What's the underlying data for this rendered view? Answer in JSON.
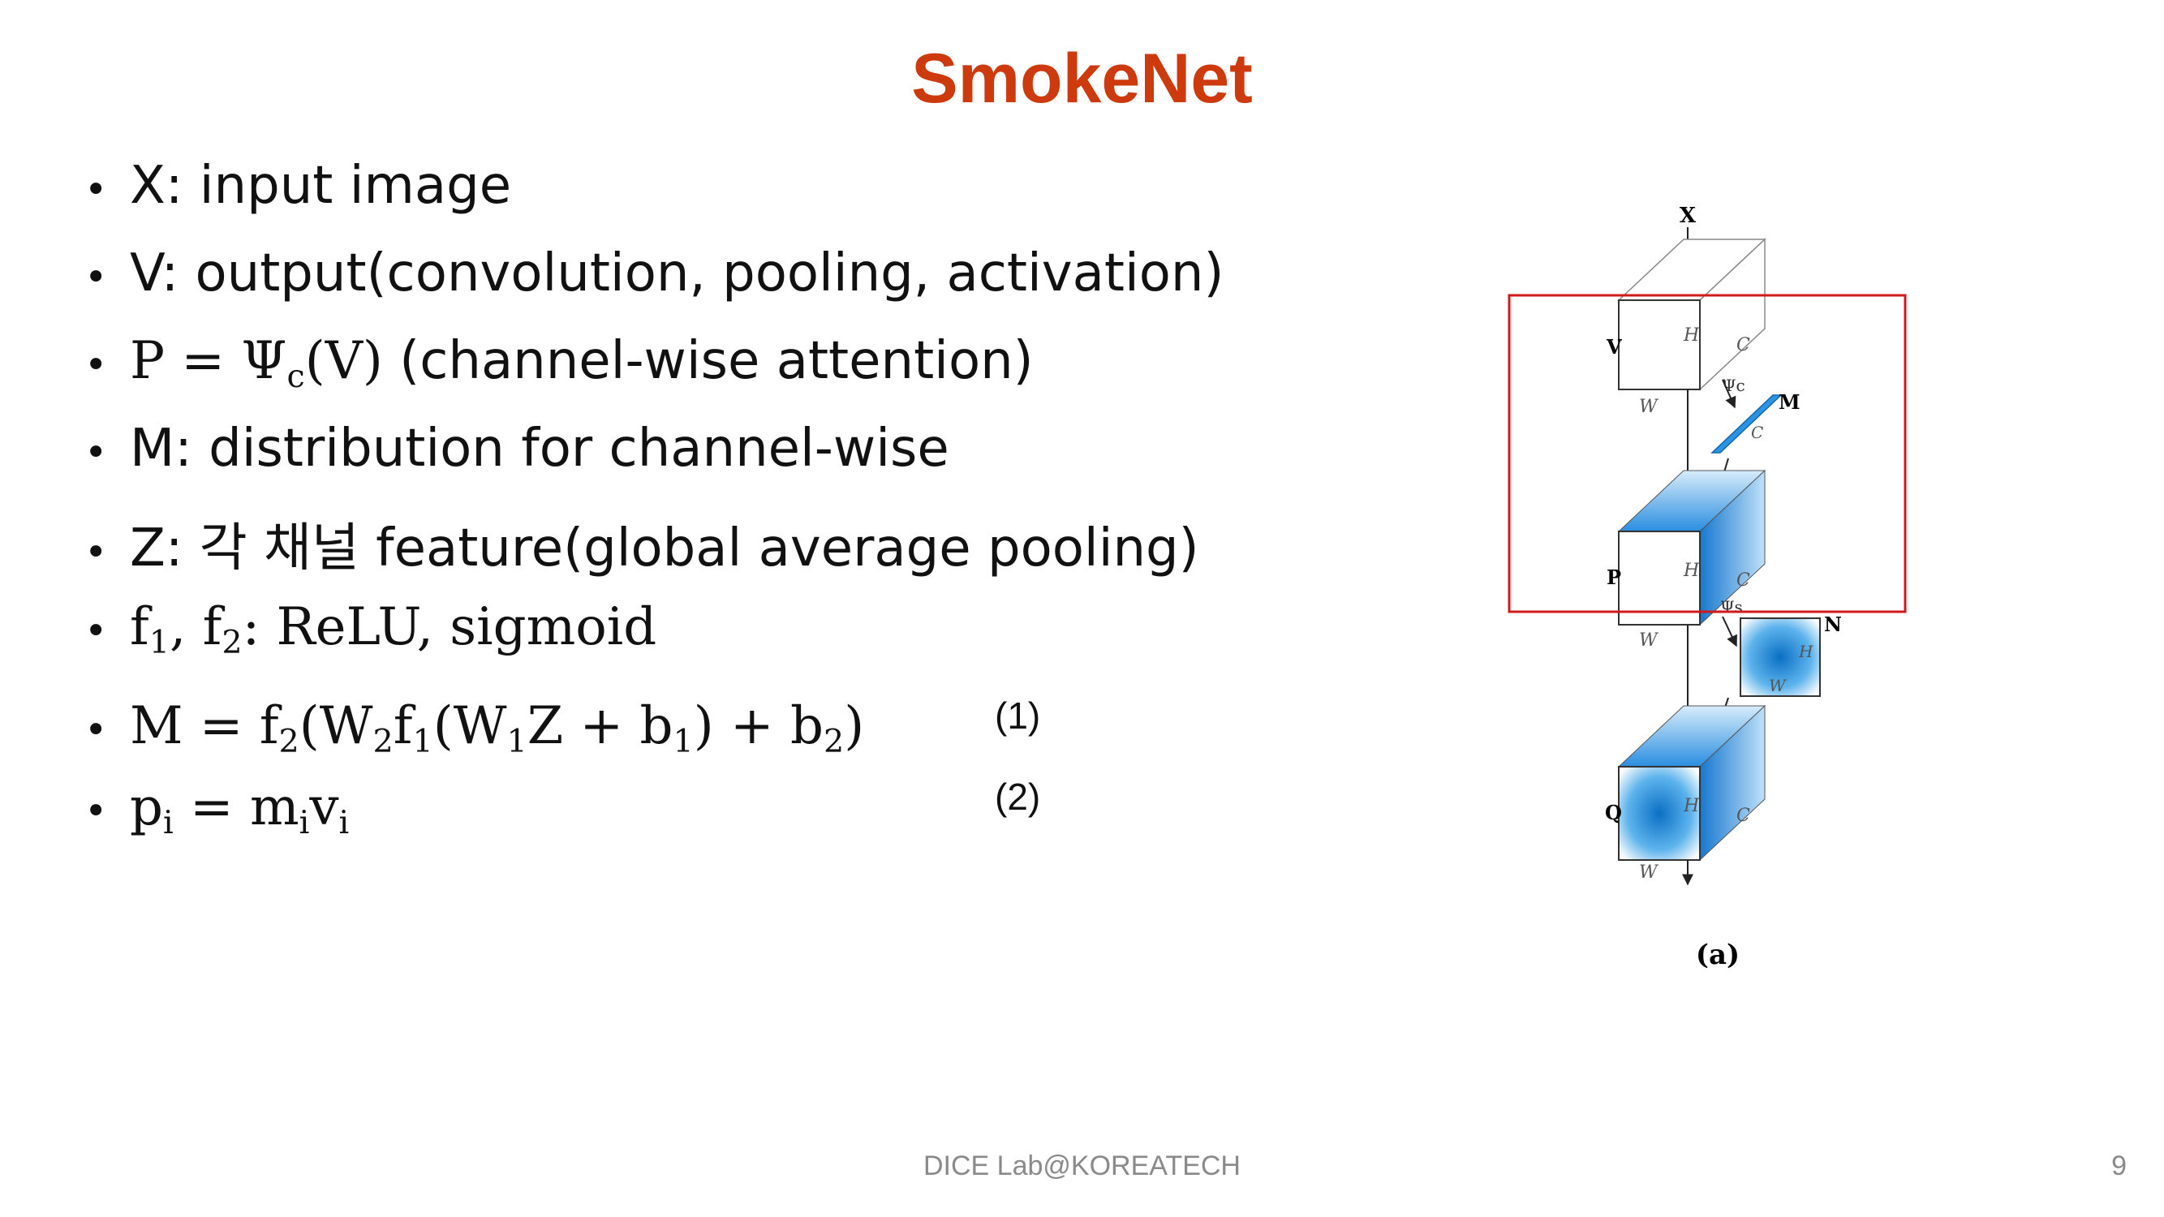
{
  "slide": {
    "title": "SmokeNet",
    "title_color": "#cc3a0d",
    "footer": "DICE Lab@KOREATECH",
    "page_number": "9"
  },
  "bullets": {
    "b1": "X: input image",
    "b2": "V: output(convolution, pooling, activation)",
    "b3_math": "P = Ψ",
    "b3_sub": "c",
    "b3_math_end": "(V)",
    "b3_text": " (channel-wise attention)",
    "b4": "M: distribution for channel-wise",
    "b5": "Z: 각 채널 feature(global average pooling)",
    "b6": {
      "f": "f",
      "s1": "1",
      "comma": ", f",
      "s2": "2",
      "rest": ": ReLU, sigmoid"
    },
    "b7": {
      "a": "M = f",
      "s1": "2",
      "b": "(W",
      "s2": "2",
      "c": "f",
      "s3": "1",
      "d": "(W",
      "s4": "1",
      "e": "Z + b",
      "s5": "1",
      "f": ") + b",
      "s6": "2",
      "g": ")"
    },
    "b8": {
      "a": "p",
      "s1": "i",
      "b": " = m",
      "s2": "i",
      "c": "v",
      "s3": "i"
    },
    "eq1": "(1)",
    "eq2": "(2)"
  },
  "figure": {
    "labels": {
      "x": "X",
      "v": "V",
      "p": "P",
      "q": "Q",
      "m": "M",
      "n": "N",
      "h": "H",
      "w": "W",
      "c": "C",
      "psi_c": "Ψc",
      "psi_s": "Ψs",
      "caption": "(a)"
    },
    "colors": {
      "highlight_box": "#d0191c",
      "attention_blue": "#1b8fe0"
    }
  }
}
